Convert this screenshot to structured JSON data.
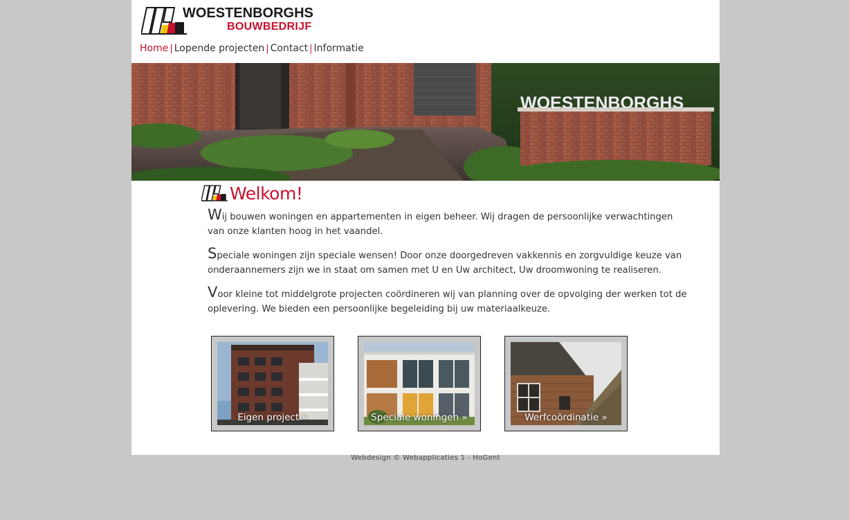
{
  "logo": {
    "line1": "WOESTENBORGHS",
    "line2": "BOUWBEDRIJF",
    "colors": {
      "dark": "#1a1a1a",
      "red": "#c8102e",
      "yellow": "#f2c500"
    }
  },
  "nav": {
    "items": [
      {
        "label": "Home",
        "active": true
      },
      {
        "label": "Lopende projecten",
        "active": false
      },
      {
        "label": "Contact",
        "active": false
      },
      {
        "label": "Informatie",
        "active": false
      }
    ],
    "separator": "|"
  },
  "banner": {
    "sign_text": "WOESTENBORGHS"
  },
  "welcome": {
    "title": "Welkom!",
    "paragraphs": [
      {
        "initial": "W",
        "rest": "ij bouwen woningen en appartementen in eigen beheer. Wij dragen de persoonlijke verwachtingen van onze klanten hoog in het vaandel."
      },
      {
        "initial": "S",
        "rest": "peciale woningen zijn speciale wensen! Door onze doorgedreven vakkennis en zorgvuldige keuze van onderaannemers zijn we in staat om samen met U en Uw architect, Uw droomwoning te realiseren."
      },
      {
        "initial": "V",
        "rest": "oor kleine tot middelgrote projecten coördineren wij van planning over de opvolging der werken tot de oplevering. We bieden een persoonlijke begeleiding bij uw materiaalkeuze."
      }
    ]
  },
  "cards": [
    {
      "label": "Eigen project »"
    },
    {
      "label": "Speciale woningen »"
    },
    {
      "label": "Werfcoördinatie »"
    }
  ],
  "footer": {
    "text": "Webdesign © Webapplicaties 1 - HoGent"
  },
  "colors": {
    "accent": "#c8102e",
    "background": "#c8c8c8",
    "page": "#ffffff"
  }
}
